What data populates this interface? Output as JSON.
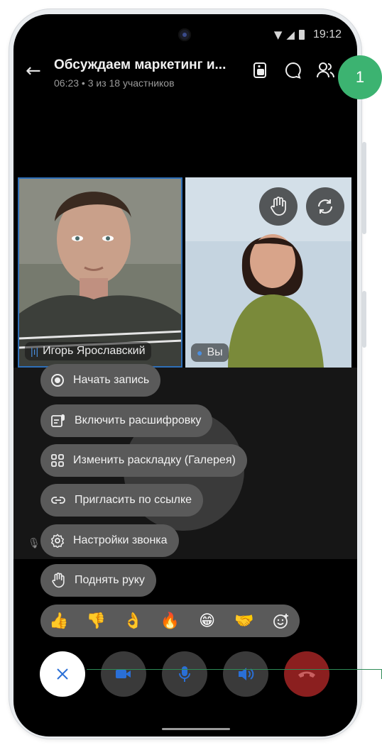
{
  "status_bar": {
    "time": "19:12"
  },
  "header": {
    "title": "Обсуждаем маркетинг и...",
    "subtitle": "06:23 • 3 из 18 участников",
    "icons": [
      "back-arrow-icon",
      "pip-icon",
      "chat-icon",
      "participants-icon"
    ]
  },
  "annotation": {
    "badge": "1",
    "color": "#3cb371"
  },
  "participants": [
    {
      "name": "Игорь Ярославский",
      "indicator": "speaking-icon"
    },
    {
      "name": "Вы",
      "indicator": "mic-icon"
    }
  ],
  "tile_buttons": [
    "raise-hand-icon",
    "switch-camera-icon"
  ],
  "menu": [
    {
      "label": "Начать запись",
      "icon": "record-icon"
    },
    {
      "label": "Включить расшифровку",
      "icon": "transcription-icon"
    },
    {
      "label": "Изменить раскладку (Галерея)",
      "icon": "grid-layout-icon"
    },
    {
      "label": "Пригласить по ссылке",
      "icon": "link-icon"
    },
    {
      "label": "Настройки звонка",
      "icon": "gear-icon"
    },
    {
      "label": "Поднять руку",
      "icon": "hand-icon"
    }
  ],
  "reactions": [
    "👍",
    "👎",
    "👌",
    "🔥",
    "😁",
    "🤝"
  ],
  "controls": {
    "close": "close-icon",
    "camera": "video-camera-icon",
    "microphone": "microphone-icon",
    "speaker": "speaker-icon",
    "end_call": "hang-up-icon"
  },
  "colors": {
    "end_call": "#8b1f1f",
    "menu_bg": "#5a5a5a",
    "accent_blue": "#2e6fb8"
  }
}
